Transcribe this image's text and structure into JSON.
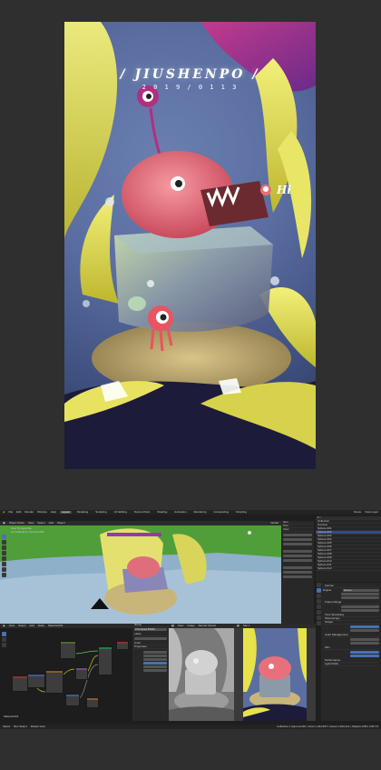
{
  "artwork": {
    "title": "/ JIUSHENPO /",
    "date": "2 0 1 9 / 0 1 1 3",
    "speech": "Hi",
    "colors": {
      "bg": "#5b6ea2",
      "yellow": "#e6e24a",
      "magenta": "#b0307f",
      "creature": "#e8707a"
    }
  },
  "blender": {
    "top_menu": [
      "File",
      "Edit",
      "Render",
      "Window",
      "Help"
    ],
    "workspaces": [
      "Layout",
      "Modeling",
      "Sculpting",
      "UV Editing",
      "Texture Paint",
      "Shading",
      "Animation",
      "Rendering",
      "Compositing",
      "Scripting"
    ],
    "active_workspace": "Layout",
    "scene_label": "Scene",
    "view_layer_label": "View Layer",
    "viewport": {
      "mode": "Object Mode",
      "menus": [
        "View",
        "Select",
        "Add",
        "Object"
      ],
      "transform": "Global",
      "overlay_text": [
        "User Perspective",
        "(1) Collection | Camera.001"
      ]
    },
    "n_panel_tabs": [
      "Item",
      "Tool",
      "View"
    ],
    "outliner_items": [
      "Collection",
      "Camera",
      "Sphere.001",
      "Sphere.002",
      "Sphere.003",
      "Sphere.004",
      "Sphere.005",
      "Sphere.006",
      "Sphere.007",
      "Sphere.008",
      "Sphere.009",
      "Sphere.010",
      "Sphere.011",
      "Sphere.012"
    ],
    "properties": {
      "sections": [
        "Format",
        "Frame Range",
        "Time Stretching",
        "Stereoscopy",
        "Output",
        "Color Management",
        "Film",
        "Performance",
        "Light Paths"
      ],
      "render_engine": "Eevee",
      "sampling_render": "Render",
      "sampling_viewport": "Viewport"
    },
    "node_editor": {
      "menus": [
        "View",
        "Select",
        "Add",
        "Node"
      ],
      "material": "Material.001",
      "footer": "Material.001"
    },
    "node_side": {
      "labels": [
        "Name",
        "Label",
        "Color",
        "Properties"
      ],
      "name_value": "Principled BSDF"
    },
    "image_editor": {
      "menus": [
        "View",
        "Image"
      ],
      "slot": "Render Result"
    },
    "render_view": {
      "label": "Slot 1"
    },
    "status_bar": {
      "left": [
        "Select",
        "Box Select",
        "Rotate View"
      ],
      "right": "Collection | Camera.001 | Verts:1,234,567 | Faces:1,203,411 | Objects:1/86 | 2.80.74"
    }
  }
}
